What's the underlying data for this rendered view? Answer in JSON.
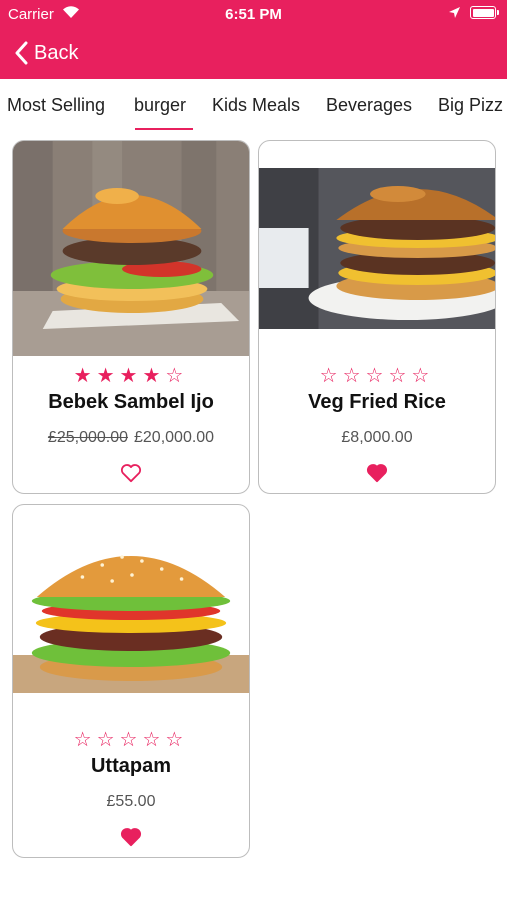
{
  "status_bar": {
    "carrier": "Carrier",
    "time": "6:51 PM"
  },
  "nav": {
    "back_label": "Back"
  },
  "colors": {
    "accent": "#e8205e",
    "card_border": "#bdbdbd"
  },
  "tabs": [
    {
      "label": "Most Selling",
      "selected": false
    },
    {
      "label": "burger",
      "selected": true
    },
    {
      "label": "Kids Meals",
      "selected": false
    },
    {
      "label": "Beverages",
      "selected": false
    },
    {
      "label": "Big Pizz",
      "selected": false
    }
  ],
  "products": [
    {
      "name": "Bebek Sambel Ijo",
      "rating": 4,
      "rating_max": 5,
      "old_price": "£25,000.00",
      "price": "£20,000.00",
      "favorite": false
    },
    {
      "name": "Veg Fried Rice",
      "rating": 0,
      "rating_max": 5,
      "old_price": "",
      "price": "£8,000.00",
      "favorite": true
    },
    {
      "name": "Uttapam",
      "rating": 0,
      "rating_max": 5,
      "old_price": "",
      "price": "£55.00",
      "favorite": true
    }
  ]
}
